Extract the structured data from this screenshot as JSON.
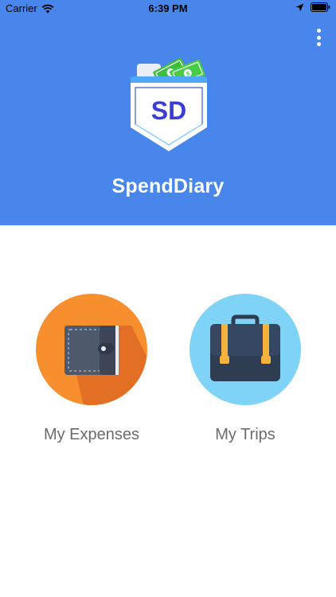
{
  "status_bar": {
    "carrier": "Carrier",
    "time": "6:39 PM",
    "icons": [
      "wifi-icon",
      "location-arrow-icon",
      "battery-icon"
    ]
  },
  "header": {
    "app_title": "SpendDiary",
    "logo_text": "SD",
    "background_color": "#4886ec",
    "menu_icon": "more-vertical-icon"
  },
  "tiles": [
    {
      "label": "My Expenses",
      "icon": "wallet-icon",
      "circle_color": "#f88f2e"
    },
    {
      "label": "My Trips",
      "icon": "briefcase-icon",
      "circle_color": "#7fd3f7"
    }
  ]
}
